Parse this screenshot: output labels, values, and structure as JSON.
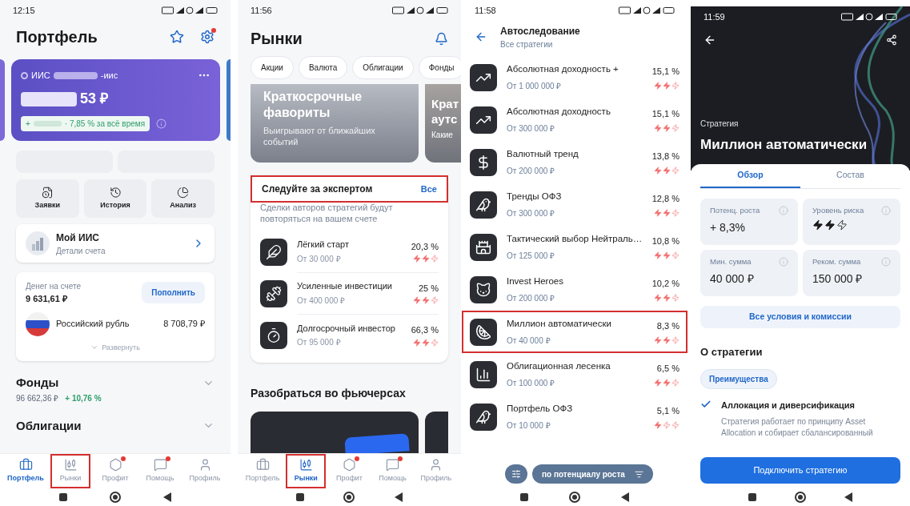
{
  "portfolio_screen": {
    "status_time": "12:15",
    "title": "Портфель",
    "account": {
      "name_start": "ИИС",
      "name_end": "-иис",
      "balance_end": "53 ₽",
      "gain_prefix": "+",
      "gain": "· 7,85 % за всё время"
    },
    "actions": [
      {
        "label": "Заявки"
      },
      {
        "label": "История"
      },
      {
        "label": "Анализ"
      }
    ],
    "iis": {
      "title": "Мой ИИС",
      "subtitle": "Детали счета"
    },
    "cash": {
      "label": "Денег на счете",
      "amount": "9 631,61 ₽",
      "button": "Пополнить",
      "currency": "Российский рубль",
      "currency_amount": "8 708,79 ₽",
      "expand": "Развернуть"
    },
    "sections": [
      {
        "title": "Фонды",
        "value": "96 662,36 ₽",
        "change": "+ 10,76 %"
      },
      {
        "title": "Облигации"
      }
    ],
    "nav": [
      {
        "label": "Портфель",
        "selected": true,
        "badge": false,
        "highlighted": false
      },
      {
        "label": "Рынки",
        "selected": false,
        "badge": false,
        "highlighted": true
      },
      {
        "label": "Профит",
        "selected": false,
        "badge": true,
        "highlighted": false
      },
      {
        "label": "Помощь",
        "selected": false,
        "badge": true,
        "highlighted": false
      },
      {
        "label": "Профиль",
        "selected": false,
        "badge": false,
        "highlighted": false
      }
    ]
  },
  "markets_screen": {
    "status_time": "11:56",
    "title": "Рынки",
    "chips": [
      "Акции",
      "Валюта",
      "Облигации",
      "Фонды"
    ],
    "promo": {
      "title": "Краткосрочные фавориты",
      "subtitle": "Выигрывают от ближайших событий"
    },
    "promo_peek": {
      "title_lines": [
        "Крат",
        "аутс"
      ],
      "subtitle": "Какие"
    },
    "expert": {
      "title": "Следуйте за экспертом",
      "link": "Все",
      "highlighted": true,
      "description": "Сделки авторов стратегий будут повторяться на вашем счете",
      "items": [
        {
          "name": "Лёгкий старт",
          "min": "От 30 000 ₽",
          "yield": "20,3 %",
          "stars": 2
        },
        {
          "name": "Усиленные инвестиции",
          "min": "От 400 000 ₽",
          "yield": "25 %",
          "stars": 2
        },
        {
          "name": "Долгосрочный инвестор",
          "min": "От 95 000 ₽",
          "yield": "66,3 %",
          "stars": 2
        }
      ]
    },
    "futures_title": "Разобраться во фьючерсах",
    "nav": [
      {
        "label": "Портфель",
        "selected": false,
        "badge": false,
        "highlighted": false
      },
      {
        "label": "Рынки",
        "selected": true,
        "badge": false,
        "highlighted": true
      },
      {
        "label": "Профит",
        "selected": false,
        "badge": true,
        "highlighted": false
      },
      {
        "label": "Помощь",
        "selected": false,
        "badge": true,
        "highlighted": false
      },
      {
        "label": "Профиль",
        "selected": false,
        "badge": false,
        "highlighted": false
      }
    ]
  },
  "autofollow_screen": {
    "status_time": "11:58",
    "title": "Автоследование",
    "subtitle": "Все стратегии",
    "strategies": [
      {
        "name": "Абсолютная доходность +",
        "min": "От 1 000 000 ₽",
        "yield": "15,1 %",
        "stars": 2,
        "highlighted": false
      },
      {
        "name": "Абсолютная доходность",
        "min": "От 300 000 ₽",
        "yield": "15,1 %",
        "stars": 2,
        "highlighted": false
      },
      {
        "name": "Валютный тренд",
        "min": "От 200 000 ₽",
        "yield": "13,8 %",
        "stars": 2,
        "highlighted": false
      },
      {
        "name": "Тренды ОФЗ",
        "min": "От 300 000 ₽",
        "yield": "12,8 %",
        "stars": 2,
        "highlighted": false
      },
      {
        "name": "Тактический выбор Нейтраль…",
        "min": "От 125 000 ₽",
        "yield": "10,8 %",
        "stars": 2,
        "highlighted": false
      },
      {
        "name": "Invest Heroes",
        "min": "От 200 000 ₽",
        "yield": "10,2 %",
        "stars": 2,
        "highlighted": false
      },
      {
        "name": "Миллион автоматически",
        "min": "От 40 000 ₽",
        "yield": "8,3 %",
        "stars": 2,
        "highlighted": true
      },
      {
        "name": "Облигационная лесенка",
        "min": "От 100 000 ₽",
        "yield": "6,5 %",
        "stars": 2,
        "highlighted": false
      },
      {
        "name": "Портфель ОФЗ",
        "min": "От 10 000 ₽",
        "yield": "5,1 %",
        "stars": 1,
        "highlighted": false
      }
    ],
    "sort_button": "по потенциалу роста"
  },
  "strategy_screen": {
    "status_time": "11:59",
    "kicker": "Стратегия",
    "title": "Миллион автоматически",
    "tabs": [
      {
        "label": "Обзор",
        "selected": true
      },
      {
        "label": "Состав",
        "selected": false
      }
    ],
    "stats": [
      {
        "kind": "text",
        "label": "Потенц. роста",
        "value": "+ 8,3%"
      },
      {
        "kind": "risk",
        "label": "Уровень риска",
        "stars": 2
      },
      {
        "kind": "text",
        "label": "Мин. сумма",
        "value": "40 000 ₽"
      },
      {
        "kind": "text",
        "label": "Реком. сумма",
        "value": "150 000 ₽"
      }
    ],
    "conditions_button": "Все условия и комиссии",
    "about_title": "О стратегии",
    "chip": "Преимущества",
    "feature": {
      "title": "Аллокация и диверсификация",
      "text": "Стратегия работает по принципу Asset Allocation и собирает сбалансированный"
    },
    "connect_button": "Подключить стратегию"
  }
}
